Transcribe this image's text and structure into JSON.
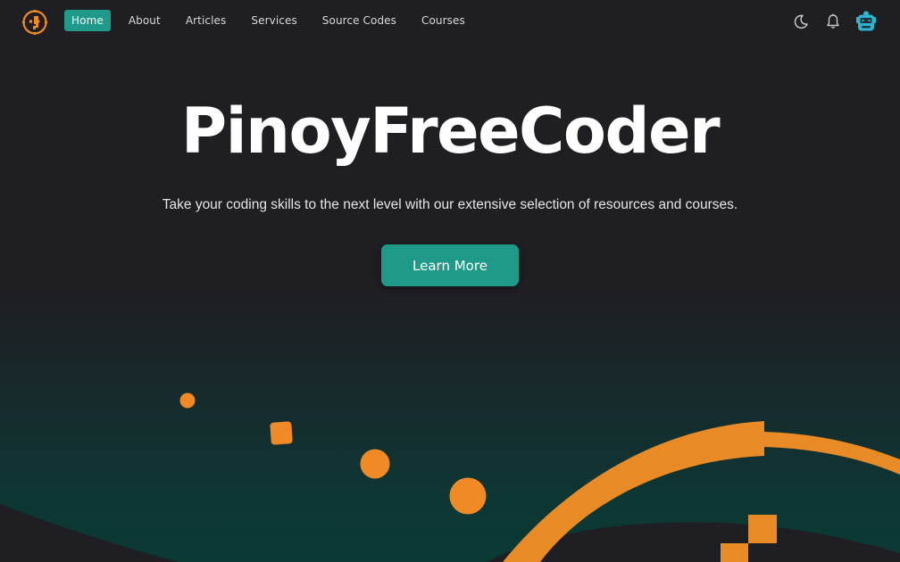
{
  "brand": {
    "logo_icon": "coder-face-logo-icon",
    "accent_color": "#1f9a8a",
    "orange_color": "#e88a26"
  },
  "nav": {
    "items": [
      {
        "label": "Home",
        "active": true
      },
      {
        "label": "About",
        "active": false
      },
      {
        "label": "Articles",
        "active": false
      },
      {
        "label": "Services",
        "active": false
      },
      {
        "label": "Source Codes",
        "active": false
      },
      {
        "label": "Courses",
        "active": false
      }
    ],
    "right_icons": [
      "moon-icon",
      "bell-icon",
      "robot-avatar-icon"
    ]
  },
  "hero": {
    "title": "PinoyFreeCoder",
    "subtitle": "Take your coding skills to the next level with our extensive selection of resources and courses.",
    "cta_label": "Learn More"
  }
}
